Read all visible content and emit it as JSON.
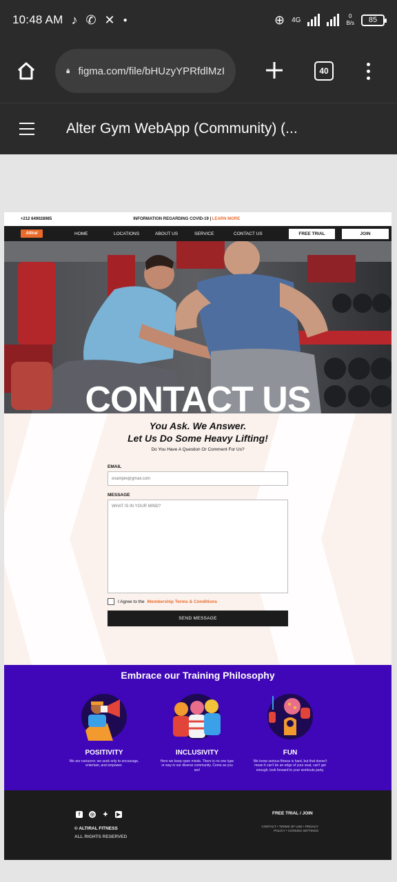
{
  "status_bar": {
    "time": "10:48 AM",
    "apps": [
      "tiktok-icon",
      "whatsapp-icon",
      "x-icon"
    ],
    "network": "4G",
    "data_speed": "0\nB/s",
    "battery": "85"
  },
  "browser": {
    "url": "figma.com/file/bHUzyYPRfdlMzI",
    "tab_count": "40"
  },
  "figma": {
    "file_title": "Alter Gym WebApp (Community) (..."
  },
  "site": {
    "topline": {
      "phone": "+212 649028985",
      "covid_text": "INFORMATION REGARDING COVID-19 |",
      "learn_more": "LEARN MORE"
    },
    "nav": {
      "logo": "Altiral",
      "links": [
        "HOME",
        "LOCATIONS",
        "ABOUT US",
        "SERVICE",
        "CONTACT US"
      ],
      "free_trial": "FREE TRIAL",
      "join": "JOIN"
    },
    "hero_title": "CONTACT US",
    "contact": {
      "heading_1": "You Ask. We Answer.",
      "heading_2": "Let Us Do Some Heavy Lifting!",
      "subheading": "Do You Have A Question Or Comment For Us?",
      "email_label": "EMAIL",
      "email_placeholder": "example@gmail.com",
      "message_label": "MESSAGE",
      "message_placeholder": "WHAT IS IN YOUR MIND?",
      "agree_text": "I Agree to the",
      "terms_link": "Membership Terms & Conditions",
      "send": "SEND MESSAGE"
    },
    "philosophy": {
      "title": "Embrace our Training Philosophy",
      "pillars": [
        {
          "title": "POSITIVITY",
          "desc": "We are nurturers: we seek only to encourage, entertain, and empower."
        },
        {
          "title": "INCLUSIVITY",
          "desc": "Here we keep open minds. There is no one type or way in our diverse community. Come as you are!"
        },
        {
          "title": "FUN",
          "desc": "We know serious fitness is hard, but that doesn't mean it can't be an edge of your seat, can't get enough, look forward to your workouts party."
        }
      ]
    },
    "footer": {
      "copyright": "© ALTIRAL FITNESS",
      "rights": "ALL RIGHTS RESERVED",
      "cta": "FREE TRIAL / JOIN",
      "links": "CONTACT • TERMS OF USE • PRIVACY POLICY • COOKIES SETTINGS",
      "social": [
        "facebook-icon",
        "instagram-icon",
        "twitter-icon",
        "youtube-icon"
      ]
    }
  },
  "colors": {
    "accent": "#e86b2c",
    "philosophy_bg": "#3f07b8",
    "dark": "#1c1c1c",
    "browser_bg": "#2b2b2b"
  }
}
